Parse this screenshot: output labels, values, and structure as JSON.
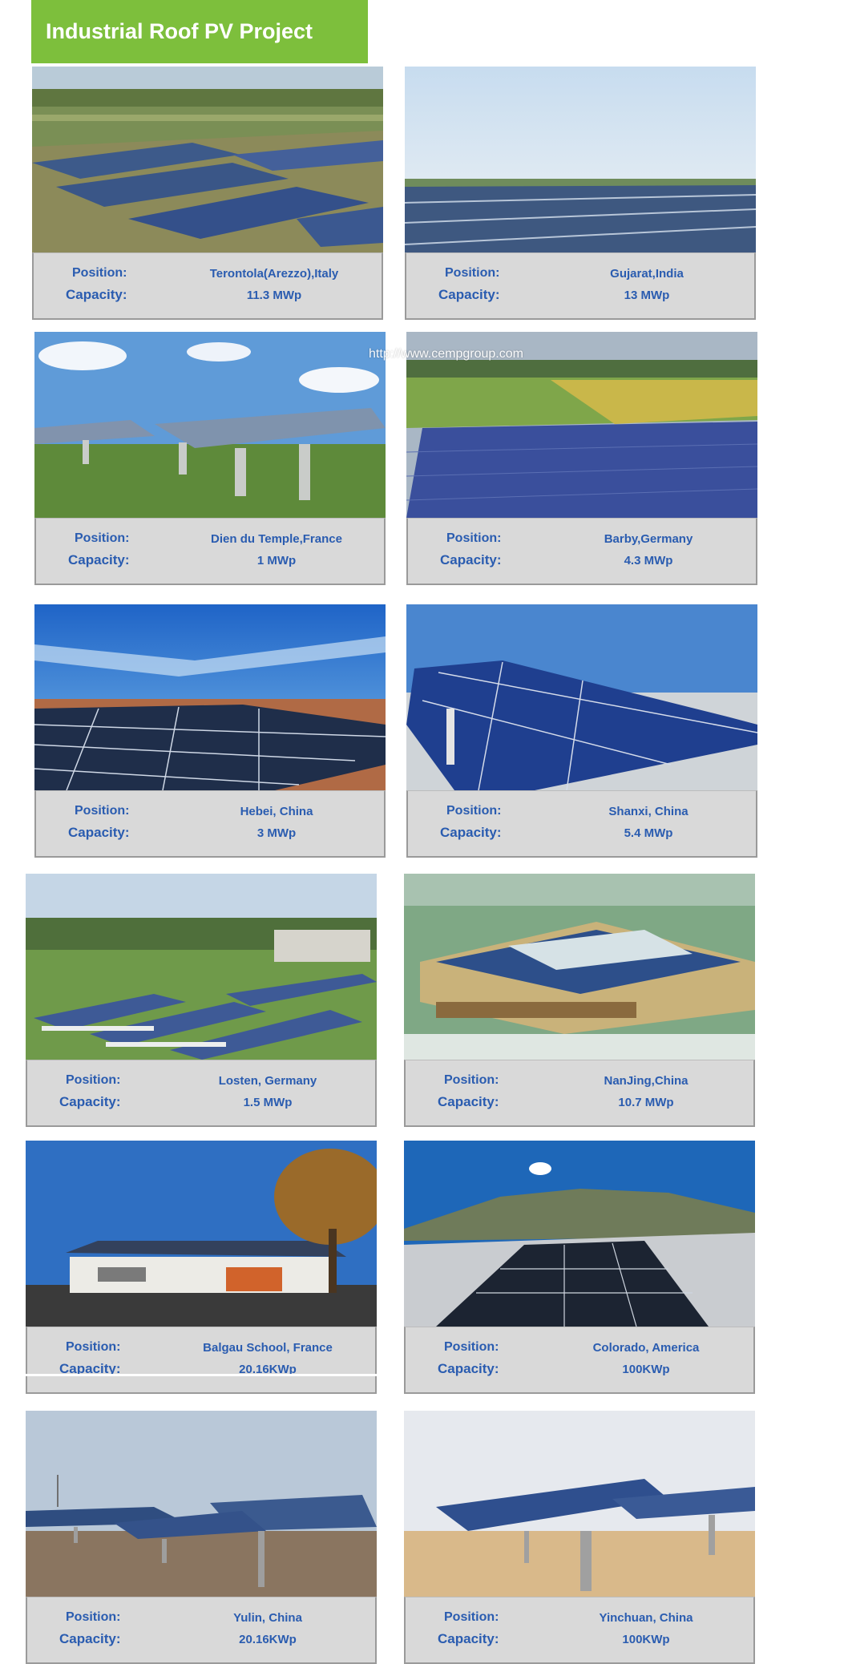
{
  "header": {
    "title": "Industrial Roof PV Project"
  },
  "labels": {
    "position": "Position:",
    "capacity": "Capacity:"
  },
  "watermark": "http://www.cempgroup.com",
  "projects": [
    {
      "position": "Terontola(Arezzo),Italy",
      "capacity": "11.3 MWp",
      "photo": "aerial-solar-farm-fields"
    },
    {
      "position": "Gujarat,India",
      "capacity": "13 MWp",
      "photo": "solar-field-haze"
    },
    {
      "position": "Dien du Temple,France",
      "capacity": "1 MWp",
      "photo": "trackers-blue-sky"
    },
    {
      "position": "Barby,Germany",
      "capacity": "4.3 MWp",
      "photo": "solar-field-yellow-fields"
    },
    {
      "position": "Hebei,  China",
      "capacity": "3 MWp",
      "photo": "rooftop-panels-deep-sky"
    },
    {
      "position": "Shanxi,  China",
      "capacity": "5.4 MWp",
      "photo": "tilted-roof-panels"
    },
    {
      "position": "Losten,  Germany",
      "capacity": "1.5 MWp",
      "photo": "barn-roofs-aerial"
    },
    {
      "position": "NanJing,China",
      "capacity": "10.7 MWp",
      "photo": "station-roof-render"
    },
    {
      "position": "Balgau  School,  France",
      "capacity": "20.16KWp",
      "photo": "school-roof-tree"
    },
    {
      "position": "Colorado, America",
      "capacity": "100KWp",
      "photo": "fisheye-roof-mountains"
    },
    {
      "position": "Yulin,     China",
      "capacity": "20.16KWp",
      "photo": "ground-mount-dirt"
    },
    {
      "position": "Yinchuan, China",
      "capacity": "100KWp",
      "photo": "ground-mount-pale-sky"
    }
  ]
}
